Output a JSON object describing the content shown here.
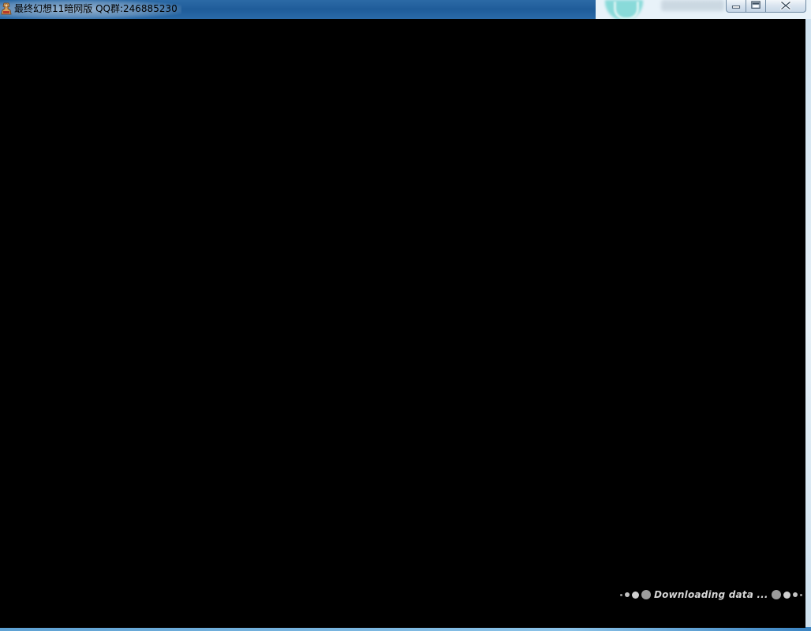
{
  "window": {
    "title": "最终幻想11暗网版 QQ群:246885230",
    "icon": "game-app-icon"
  },
  "controls": {
    "minimize": "minimize-icon",
    "maximize": "maximize-icon",
    "close": "close-icon"
  },
  "game": {
    "loading_text": "Downloading data ..."
  },
  "colors": {
    "titlebar": "#1f5c99",
    "game_background": "#000000",
    "loading_text": "#d6d6d6"
  }
}
